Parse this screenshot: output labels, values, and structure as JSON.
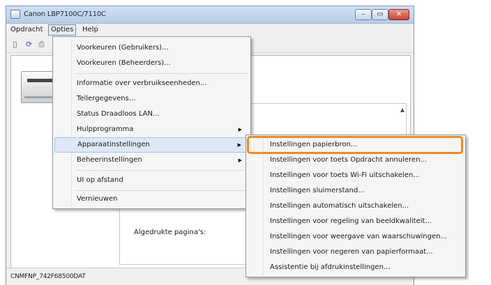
{
  "window": {
    "title": "Canon LBP7100C/7110C",
    "caption_min": "–",
    "caption_max": "▭",
    "caption_close": "✕"
  },
  "menubar": {
    "items": [
      "Opdracht",
      "Opties",
      "Help"
    ]
  },
  "toolbar": {
    "icons": [
      "sheet-icon",
      "refresh-icon",
      "printer-icon"
    ],
    "glyphs": [
      "▯",
      "⟳",
      "⎙"
    ]
  },
  "content": {
    "printed_pages_label": "Algedrukte pagina's:"
  },
  "statusbar": {
    "text": "CNMFNP_742F68500DAT"
  },
  "options_menu": {
    "items": [
      "Voorkeuren (Gebruikers)...",
      "Voorkeuren (Beheerders)...",
      "Informatie over verbruikseenheden...",
      "Tellergegevens...",
      "Status Draadloos LAN...",
      "Hulpprogramma",
      "Apparaatinstellingen",
      "Beheerinstellingen",
      "UI op afstand",
      "Vernieuwen"
    ]
  },
  "submenu": {
    "items": [
      "Instellingen papierbron...",
      "Instellingen voor toets Opdracht annuleren...",
      "Instellingen voor toets Wi-Fi uitschakelen...",
      "Instellingen sluimerstand...",
      "Instellingen automatisch uitschakelen...",
      "Instellingen voor regeling van beeldkwaliteit...",
      "Instellingen voor weergave van waarschuwingen...",
      "Instellingen voor negeren van papierformaat...",
      "Assistentie bij afdrukinstellingen..."
    ]
  },
  "colors": {
    "highlight_ring": "#f08a24",
    "menu_highlight": "#dde8f7",
    "titlebar": "#c4d7ef"
  }
}
